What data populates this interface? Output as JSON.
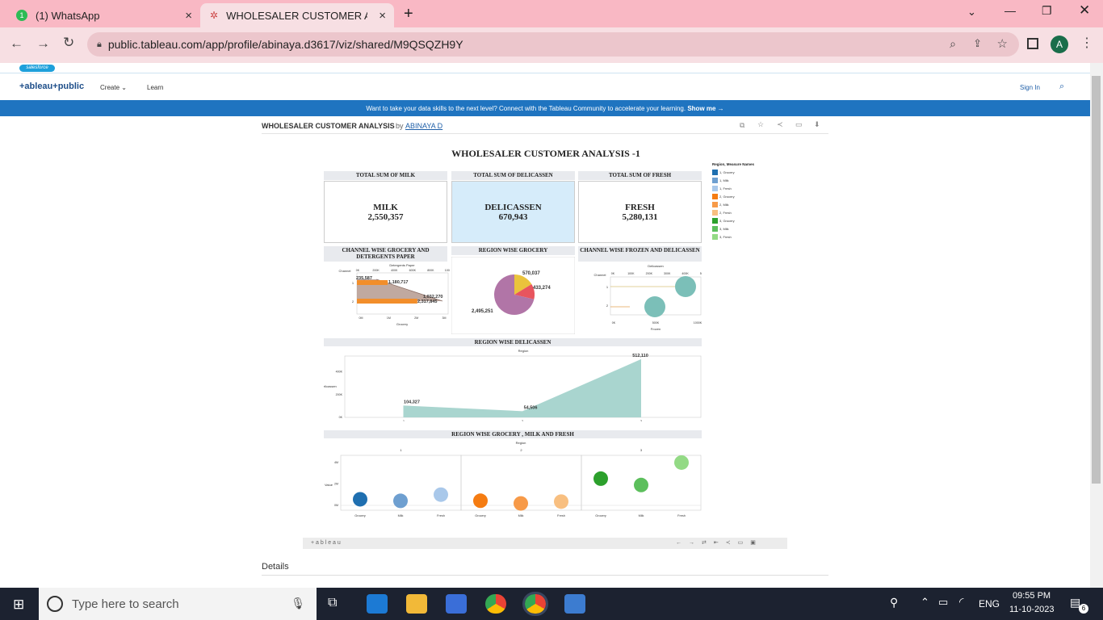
{
  "browser": {
    "tabs": [
      {
        "label": "(1) WhatsApp",
        "badge": "1"
      },
      {
        "label": "WHOLESALER CUSTOMER ANAL"
      }
    ],
    "new_tab": "+",
    "close": "×",
    "url": "public.tableau.com/app/profile/abinaya.d3617/viz/shared/M9QSQZH9Y",
    "profile_initial": "A"
  },
  "page": {
    "salesforce": "salesforce",
    "logo": "+ableau+public",
    "nav": {
      "create": "Create",
      "learn": "Learn",
      "signin": "Sign In"
    },
    "banner_text": "Want to take your data skills to the next level? Connect with the Tableau Community to accelerate your learning.",
    "banner_link": "Show me →",
    "viz_title": "WHOLESALER CUSTOMER ANALYSIS",
    "viz_by": "by",
    "viz_author": "ABINAYA D",
    "details": "Details",
    "bottom_logo": "+ a b l e a u"
  },
  "dashboard": {
    "title": "WHOLESALER CUSTOMER ANALYSIS -1",
    "kpis": [
      {
        "header": "TOTAL SUM OF MILK",
        "name": "MILK",
        "value": "2,550,357",
        "bg": "#ffffff"
      },
      {
        "header": "TOTAL SUM OF DELICASSEN",
        "name": "DELICASSEN",
        "value": "670,943",
        "bg": "#d6ecfa"
      },
      {
        "header": "TOTAL SUM OF FRESH",
        "name": "FRESH",
        "value": "5,280,131",
        "bg": "#ffffff"
      }
    ],
    "legend": {
      "title": "Region, Measure Names",
      "items": [
        {
          "label": "1, Grocery",
          "color": "#1f6fb0"
        },
        {
          "label": "1, Milk",
          "color": "#6e9fd0"
        },
        {
          "label": "1, Fresh",
          "color": "#a9c8ea"
        },
        {
          "label": "2, Grocery",
          "color": "#f57c12"
        },
        {
          "label": "2, Milk",
          "color": "#f79a48"
        },
        {
          "label": "2, Fresh",
          "color": "#f8bf80"
        },
        {
          "label": "3, Grocery",
          "color": "#2ca02c"
        },
        {
          "label": "3, Milk",
          "color": "#5cbf5c"
        },
        {
          "label": "3, Fresh",
          "color": "#93da85"
        }
      ]
    }
  },
  "chart_data": [
    {
      "type": "bar",
      "title": "CHANNEL WISE GROCERY AND DETERGENTS PAPER",
      "rowlabel": "Channel",
      "categories": [
        "1",
        "2"
      ],
      "top_axis_label": "Detergents Paper",
      "top_ticks": [
        "0K",
        "200K",
        "400K",
        "600K",
        "800K",
        "1000K"
      ],
      "xlabel": "Grocery",
      "bottom_ticks": [
        "0M",
        "1M",
        "2M",
        "3M"
      ],
      "series": [
        {
          "name": "Grocery",
          "values": [
            1180717,
            2317845
          ]
        },
        {
          "name": "Detergents Paper",
          "values": [
            235587,
            1032270
          ]
        }
      ],
      "labels": [
        "1,180,717",
        "235,587",
        "1,032,270",
        "2,317,845"
      ]
    },
    {
      "type": "pie",
      "title": "REGION WISE GROCERY",
      "values": [
        2495251,
        433274,
        570037
      ],
      "labels": [
        "2,495,251",
        "433,274",
        "570,037"
      ],
      "colors": [
        "#b175a7",
        "#e8555e",
        "#eac33c"
      ]
    },
    {
      "type": "scatter",
      "title": "CHANNEL WISE FROZEN AND DELICASSEN",
      "rowlabel": "Channel",
      "categories": [
        "1",
        "2"
      ],
      "top_axis_label": "Delicassen",
      "top_ticks": [
        "0K",
        "100K",
        "200K",
        "300K",
        "400K",
        "500K"
      ],
      "xlabel": "Frozen",
      "bottom_ticks": [
        "0K",
        "500K",
        "1000K"
      ]
    },
    {
      "type": "area",
      "title": "REGION WISE DELICASSEN",
      "top_label": "Region",
      "ylabel": "Delicassen",
      "categories": [
        "1",
        "2",
        "3"
      ],
      "values": [
        104327,
        54506,
        512110
      ],
      "labels": [
        "104,327",
        "54,506",
        "512,110"
      ],
      "yticks": [
        "0K",
        "200K",
        "400K"
      ],
      "ylim": [
        0,
        540000
      ]
    },
    {
      "type": "scatter",
      "title": "REGION WISE GROCERY , MILK AND FRESH",
      "top_label": "Region",
      "ylabel": "Value",
      "regions": [
        "1",
        "2",
        "3"
      ],
      "measures": [
        "Grocery",
        "Milk",
        "Fresh"
      ],
      "yticks": [
        "0M",
        "2M",
        "4M"
      ],
      "ylim": [
        0,
        4600000
      ],
      "series": [
        {
          "name": "1",
          "values": [
            570037,
            423000,
            1000000
          ]
        },
        {
          "name": "2",
          "values": [
            433274,
            180000,
            350000
          ]
        },
        {
          "name": "3",
          "values": [
            2495251,
            1900000,
            4000000
          ]
        }
      ]
    }
  ],
  "taskbar": {
    "search_placeholder": "Type here to search",
    "lang": "ENG",
    "time": "09:55 PM",
    "date": "11-10-2023",
    "notif": "6"
  }
}
